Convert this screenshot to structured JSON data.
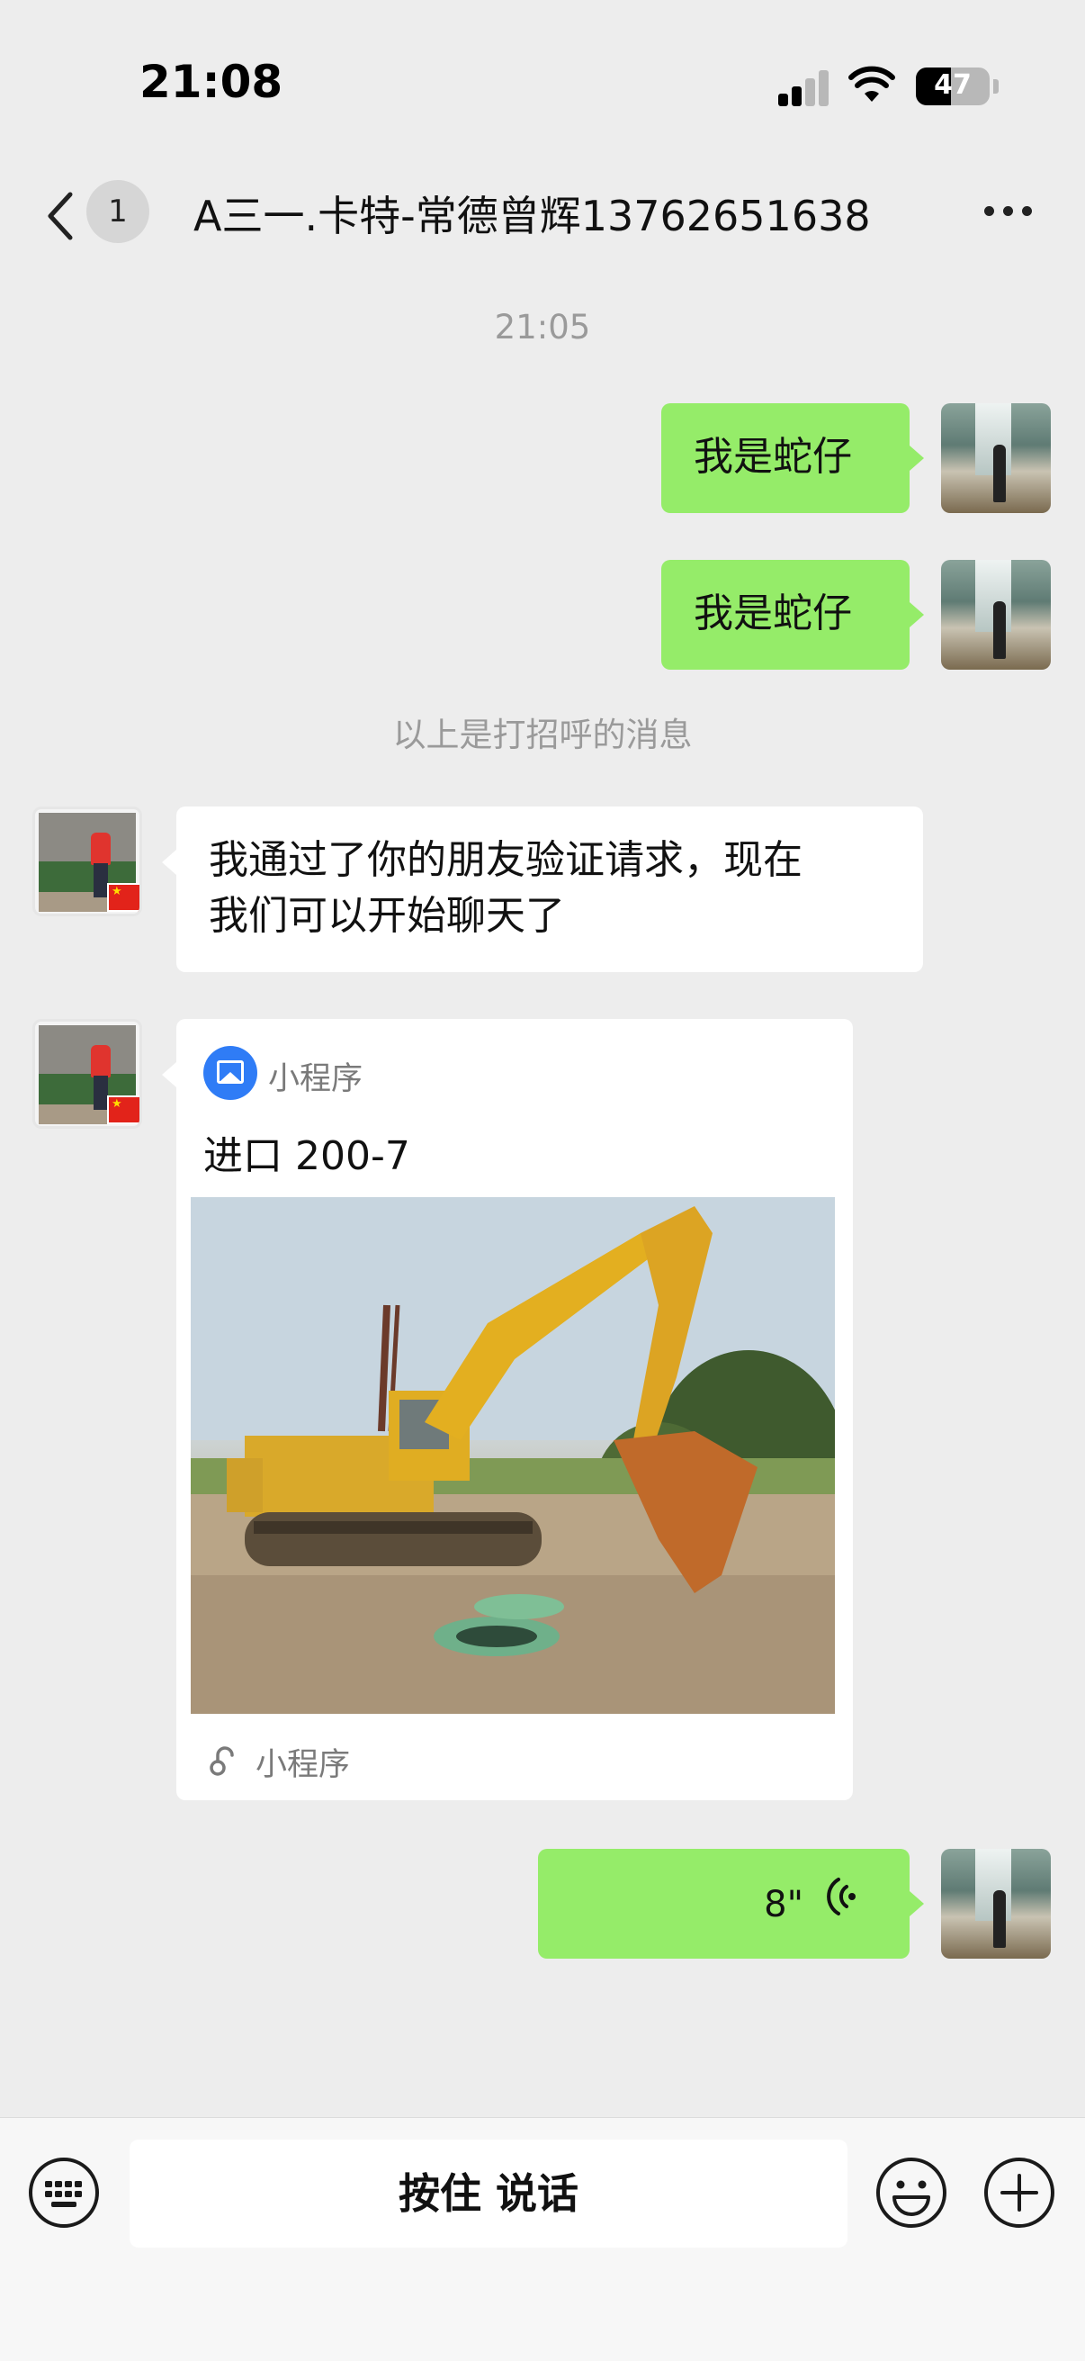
{
  "status_bar": {
    "time": "21:08",
    "battery": "47",
    "battery_level": 0.47
  },
  "nav": {
    "unread_count": "1",
    "title": "A三一.卡特-常德曾辉13762651638"
  },
  "chat": {
    "timestamp": "21:05",
    "messages": [
      {
        "side": "right",
        "text": "我是蛇仔"
      },
      {
        "side": "right",
        "text": "我是蛇仔"
      }
    ],
    "system_notice": "以上是打招呼的消息",
    "friend_message_line1": "我通过了你的朋友验证请求，现在",
    "friend_message_line2": "我们可以开始聊天了",
    "mini_program": {
      "source_label": "小程序",
      "title": "进口 200-7",
      "footer_label": "小程序"
    },
    "voice": {
      "duration": "8\""
    }
  },
  "input_bar": {
    "talk_label": "按住 说话"
  },
  "colors": {
    "bubble_green": "#95ec69",
    "background": "#ededed",
    "card_accent": "#2f7cf6"
  },
  "icons": [
    "back-icon",
    "more-icon",
    "mini-program-icon",
    "link-icon",
    "voice-wave-icon",
    "keyboard-icon",
    "emoji-icon",
    "plus-icon"
  ]
}
